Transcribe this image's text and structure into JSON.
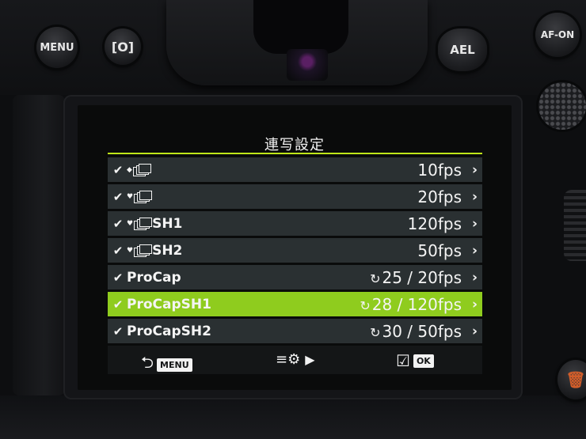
{
  "camera": {
    "buttons": {
      "menu": "MENU",
      "lv": "[O]",
      "ael": "AEL",
      "afon": "AF-ON",
      "trash": "🗑"
    }
  },
  "screen": {
    "title": "連写設定",
    "items": [
      {
        "checked": true,
        "label": "",
        "mark": "◆",
        "value": "10fps",
        "cycle": "",
        "selected": false
      },
      {
        "checked": true,
        "label": "",
        "mark": "♥",
        "value": "20fps",
        "cycle": "",
        "selected": false
      },
      {
        "checked": true,
        "label": "SH1",
        "mark": "♥",
        "value": "120fps",
        "cycle": "",
        "selected": false
      },
      {
        "checked": true,
        "label": "SH2",
        "mark": "♥",
        "value": "50fps",
        "cycle": "",
        "selected": false
      },
      {
        "checked": true,
        "label": "ProCap",
        "mark": "",
        "value": "25 / 20fps",
        "cycle": "↻",
        "selected": false
      },
      {
        "checked": true,
        "label": "ProCapSH1",
        "mark": "",
        "value": "28 / 120fps",
        "cycle": "↻",
        "selected": true
      },
      {
        "checked": true,
        "label": "ProCapSH2",
        "mark": "",
        "value": "30 / 50fps",
        "cycle": "↻",
        "selected": false
      }
    ],
    "check_glyph": "✔",
    "chevron_glyph": "›",
    "footer": {
      "back_arrow": "⮌",
      "back_tag": "MENU",
      "settings_icon": "≡⚙",
      "settings_arrow": "▶",
      "ok_box": "☑",
      "ok_tag": "OK"
    }
  },
  "colors": {
    "accent": "#8fcc1e",
    "row_bg": "#2a3032",
    "rule": "#bfe619"
  }
}
